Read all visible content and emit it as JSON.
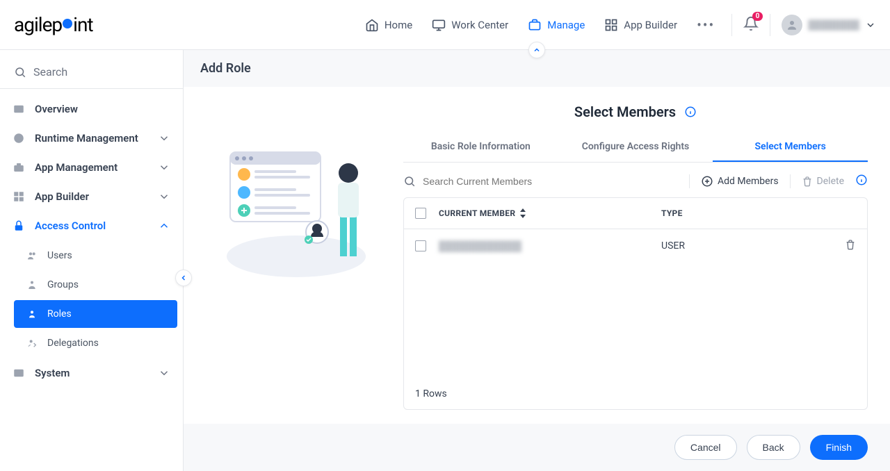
{
  "header": {
    "logo_text": "agilepoint",
    "nav": [
      {
        "label": "Home",
        "icon": "home"
      },
      {
        "label": "Work Center",
        "icon": "monitor"
      },
      {
        "label": "Manage",
        "icon": "briefcase",
        "active": true
      },
      {
        "label": "App Builder",
        "icon": "apps"
      }
    ],
    "notif_count": "0",
    "user_name": "████████"
  },
  "sidebar": {
    "search_placeholder": "Search",
    "items": [
      {
        "label": "Overview",
        "icon": "chart",
        "expandable": false
      },
      {
        "label": "Runtime Management",
        "icon": "clock",
        "expandable": true
      },
      {
        "label": "App Management",
        "icon": "briefcase",
        "expandable": true
      },
      {
        "label": "App Builder",
        "icon": "grid",
        "expandable": true
      },
      {
        "label": "Access Control",
        "icon": "lock",
        "expandable": true,
        "expanded": true,
        "children": [
          {
            "label": "Users",
            "icon": "users"
          },
          {
            "label": "Groups",
            "icon": "group"
          },
          {
            "label": "Roles",
            "icon": "role",
            "active": true
          },
          {
            "label": "Delegations",
            "icon": "delegation"
          }
        ]
      },
      {
        "label": "System",
        "icon": "system",
        "expandable": true
      }
    ]
  },
  "page": {
    "title": "Add Role",
    "section_title": "Select Members",
    "tabs": [
      {
        "label": "Basic Role Information"
      },
      {
        "label": "Configure Access Rights"
      },
      {
        "label": "Select Members",
        "active": true
      }
    ],
    "toolbar": {
      "search_placeholder": "Search Current Members",
      "add_label": "Add Members",
      "delete_label": "Delete"
    },
    "table": {
      "headers": {
        "member": "CURRENT MEMBER",
        "type": "TYPE"
      },
      "rows": [
        {
          "member": "████████████",
          "type": "USER"
        }
      ],
      "footer": "1 Rows"
    },
    "buttons": {
      "cancel": "Cancel",
      "back": "Back",
      "finish": "Finish"
    }
  }
}
